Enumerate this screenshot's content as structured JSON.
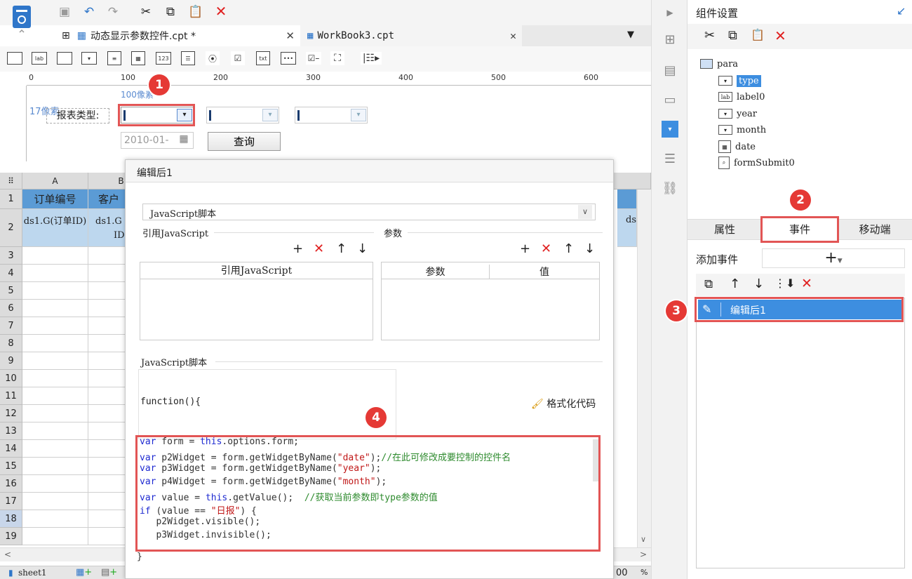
{
  "tabs": [
    {
      "label": "动态显示参数控件.cpt *"
    },
    {
      "label": "WorkBook3.cpt"
    }
  ],
  "ruler": {
    "ticks": [
      "0",
      "100",
      "200",
      "300",
      "400",
      "500",
      "600"
    ]
  },
  "param_pane": {
    "width_hint": "100像素",
    "height_hint": "17像素",
    "label": "报表类型:",
    "date_placeholder": "2010-01-",
    "query_button": "查询"
  },
  "sheet": {
    "columns": [
      "A",
      "B"
    ],
    "row1": {
      "a": "订单编号",
      "b": "客户"
    },
    "row2": {
      "a": "ds1.G(订单ID)",
      "b": "ds1.G",
      "b2": "ID",
      "right": "ds"
    },
    "rows": [
      "1",
      "2",
      "3",
      "4",
      "5",
      "6",
      "7",
      "8",
      "9",
      "10",
      "11",
      "12",
      "13",
      "14",
      "15",
      "16",
      "17",
      "18",
      "19"
    ],
    "sheet_tab": "sheet1",
    "zoom_partial": "00",
    "zoom_pct": "%"
  },
  "dialog": {
    "title": "编辑后1",
    "type_select": "JavaScript脚本",
    "ref_js_label": "引用JavaScript",
    "ref_js_header": "引用JavaScript",
    "params_label": "参数",
    "params_header_param": "参数",
    "params_header_value": "值",
    "script_label": "JavaScript脚本",
    "function_head": "function(){",
    "format_code": "格式化代码",
    "closing_brace": "}",
    "code": {
      "l1_kw": "var",
      "l1_rest": " form = ",
      "l1_kw2": "this",
      "l1_end": ".options.form;",
      "l2_kw": "var",
      "l2_rest": " p2Widget = form.getWidgetByName(",
      "l2_str": "\"date\"",
      "l2_end": ");",
      "l2_cmt": "//在此可修改成要控制的控件名",
      "l3_kw": "var",
      "l3_rest": " p3Widget = form.getWidgetByName(",
      "l3_str": "\"year\"",
      "l3_end": ");",
      "l4_kw": "var",
      "l4_rest": " p4Widget = form.getWidgetByName(",
      "l4_str": "\"month\"",
      "l4_end": ");",
      "l5_kw": "var",
      "l5_rest": " value = ",
      "l5_kw2": "this",
      "l5_end": ".getValue();  ",
      "l5_cmt": "//获取当前参数即type参数的值",
      "l6_kw": "if",
      "l6_rest": " (value == ",
      "l6_str": "\"日报\"",
      "l6_end": ") {",
      "l7": "   p2Widget.visible();",
      "l8": "   p3Widget.invisible();"
    }
  },
  "right_panel": {
    "title": "组件设置",
    "tree": [
      {
        "label": "para",
        "icon": "form-icon"
      },
      {
        "label": "type",
        "icon": "combo-icon"
      },
      {
        "label": "label0",
        "icon": "label-icon",
        "icon_text": "lab"
      },
      {
        "label": "year",
        "icon": "combo-icon"
      },
      {
        "label": "month",
        "icon": "combo-icon"
      },
      {
        "label": "date",
        "icon": "calendar-icon"
      },
      {
        "label": "formSubmit0",
        "icon": "submit-icon"
      }
    ],
    "tabs": [
      "属性",
      "事件",
      "移动端"
    ],
    "add_event_label": "添加事件",
    "add_event_plus": "+",
    "event_item": "编辑后1"
  },
  "badges": [
    "1",
    "2",
    "3",
    "4"
  ],
  "colors": {
    "highlight": "#e25555",
    "selected_blue": "#3d8ee0",
    "keyword": "#1f2bd1",
    "string": "#c01818",
    "comment": "#2e8b2e",
    "header_blue": "#5b9bd5",
    "row_blue": "#bdd7ee"
  }
}
